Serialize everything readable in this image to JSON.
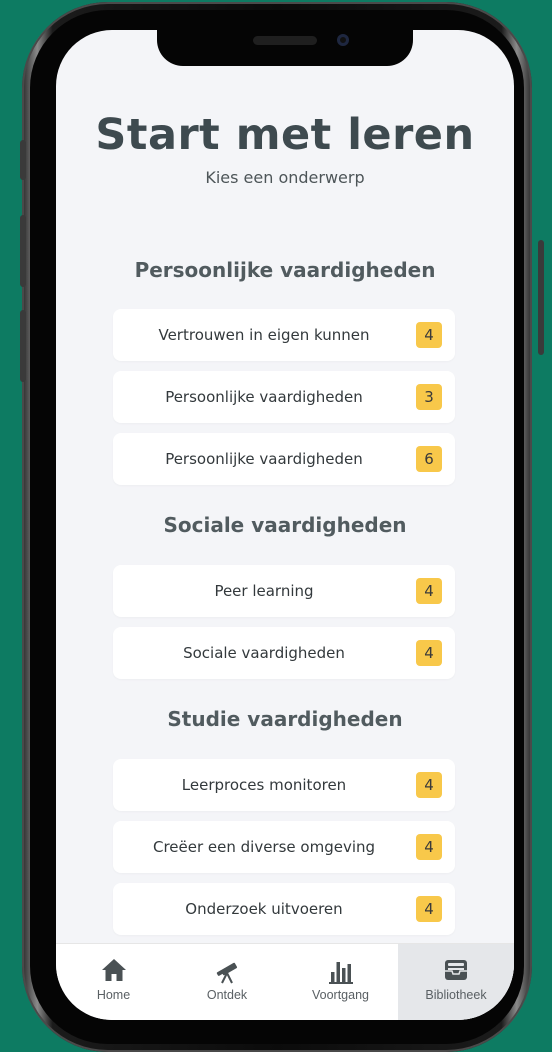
{
  "header": {
    "title": "Start met leren",
    "subtitle": "Kies een onderwerp"
  },
  "sections": [
    {
      "title": "Persoonlijke vaardigheden",
      "items": [
        {
          "label": "Vertrouwen in eigen kunnen",
          "count": "4"
        },
        {
          "label": "Persoonlijke vaardigheden",
          "count": "3"
        },
        {
          "label": "Persoonlijke vaardigheden",
          "count": "6"
        }
      ]
    },
    {
      "title": "Sociale vaardigheden",
      "items": [
        {
          "label": "Peer learning",
          "count": "4"
        },
        {
          "label": "Sociale vaardigheden",
          "count": "4"
        }
      ]
    },
    {
      "title": "Studie vaardigheden",
      "items": [
        {
          "label": "Leerproces monitoren",
          "count": "4"
        },
        {
          "label": "Creëer een diverse omgeving",
          "count": "4"
        },
        {
          "label": "Onderzoek uitvoeren",
          "count": "4"
        }
      ]
    }
  ],
  "tabbar": {
    "tabs": [
      {
        "label": "Home",
        "icon": "home-icon"
      },
      {
        "label": "Ontdek",
        "icon": "telescope-icon"
      },
      {
        "label": "Voortgang",
        "icon": "bar-chart-icon"
      },
      {
        "label": "Bibliotheek",
        "icon": "archive-box-icon",
        "active": true
      }
    ]
  },
  "colors": {
    "background": "#0d7b62",
    "screen": "#f4f5f8",
    "badge": "#f8c84a",
    "title": "#3e4a4f"
  }
}
